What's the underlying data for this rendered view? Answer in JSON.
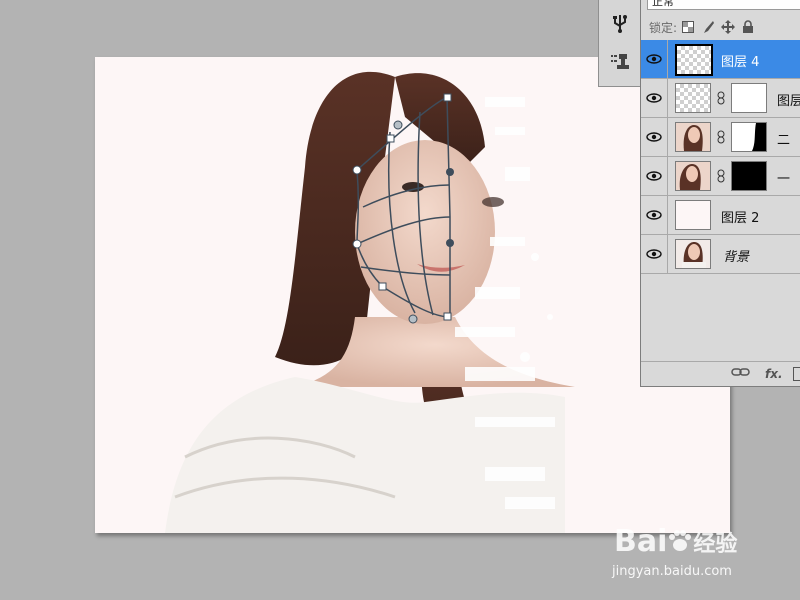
{
  "layers_panel": {
    "blend_mode": "正常",
    "lock_label": "锁定:",
    "lock_icons": [
      "lock-transparent-icon",
      "lock-brush-icon",
      "lock-move-icon",
      "lock-all-icon"
    ],
    "layers": [
      {
        "name": "图层 4",
        "selected": true,
        "visible": true,
        "thumb": "transparent",
        "mask": null
      },
      {
        "name": "图层",
        "selected": false,
        "visible": true,
        "thumb": "transparent",
        "mask": "white"
      },
      {
        "name": "二",
        "selected": false,
        "visible": true,
        "thumb": "portrait",
        "mask": "white-with-black"
      },
      {
        "name": "一",
        "selected": false,
        "visible": true,
        "thumb": "portrait",
        "mask": "black"
      },
      {
        "name": "图层 2",
        "selected": false,
        "visible": true,
        "thumb": "white",
        "mask": null
      },
      {
        "name": "背景",
        "selected": false,
        "visible": true,
        "thumb": "portrait",
        "mask": null
      }
    ],
    "footer_icons": [
      "link-icon",
      "fx-icon",
      "mask-icon"
    ],
    "fx_label": "fx."
  },
  "toolstrip": {
    "tools": [
      "usb-icon",
      "layers-stamp-icon"
    ]
  },
  "watermark": {
    "brand": "Bai",
    "brand_suffix": "经验",
    "url": "jingyan.baidu.com"
  },
  "colors": {
    "selection": "#3b8ae6",
    "canvas_bg": "#fdf6f6",
    "workspace": "#b3b3b3",
    "panel": "#d9d9d9"
  }
}
